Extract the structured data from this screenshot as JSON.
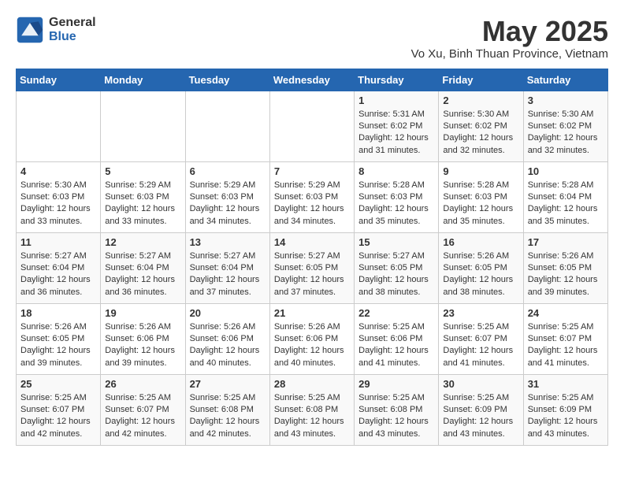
{
  "header": {
    "logo_general": "General",
    "logo_blue": "Blue",
    "month_year": "May 2025",
    "location": "Vo Xu, Binh Thuan Province, Vietnam"
  },
  "weekdays": [
    "Sunday",
    "Monday",
    "Tuesday",
    "Wednesday",
    "Thursday",
    "Friday",
    "Saturday"
  ],
  "weeks": [
    [
      {
        "day": "",
        "detail": ""
      },
      {
        "day": "",
        "detail": ""
      },
      {
        "day": "",
        "detail": ""
      },
      {
        "day": "",
        "detail": ""
      },
      {
        "day": "1",
        "detail": "Sunrise: 5:31 AM\nSunset: 6:02 PM\nDaylight: 12 hours\nand 31 minutes."
      },
      {
        "day": "2",
        "detail": "Sunrise: 5:30 AM\nSunset: 6:02 PM\nDaylight: 12 hours\nand 32 minutes."
      },
      {
        "day": "3",
        "detail": "Sunrise: 5:30 AM\nSunset: 6:02 PM\nDaylight: 12 hours\nand 32 minutes."
      }
    ],
    [
      {
        "day": "4",
        "detail": "Sunrise: 5:30 AM\nSunset: 6:03 PM\nDaylight: 12 hours\nand 33 minutes."
      },
      {
        "day": "5",
        "detail": "Sunrise: 5:29 AM\nSunset: 6:03 PM\nDaylight: 12 hours\nand 33 minutes."
      },
      {
        "day": "6",
        "detail": "Sunrise: 5:29 AM\nSunset: 6:03 PM\nDaylight: 12 hours\nand 34 minutes."
      },
      {
        "day": "7",
        "detail": "Sunrise: 5:29 AM\nSunset: 6:03 PM\nDaylight: 12 hours\nand 34 minutes."
      },
      {
        "day": "8",
        "detail": "Sunrise: 5:28 AM\nSunset: 6:03 PM\nDaylight: 12 hours\nand 35 minutes."
      },
      {
        "day": "9",
        "detail": "Sunrise: 5:28 AM\nSunset: 6:03 PM\nDaylight: 12 hours\nand 35 minutes."
      },
      {
        "day": "10",
        "detail": "Sunrise: 5:28 AM\nSunset: 6:04 PM\nDaylight: 12 hours\nand 35 minutes."
      }
    ],
    [
      {
        "day": "11",
        "detail": "Sunrise: 5:27 AM\nSunset: 6:04 PM\nDaylight: 12 hours\nand 36 minutes."
      },
      {
        "day": "12",
        "detail": "Sunrise: 5:27 AM\nSunset: 6:04 PM\nDaylight: 12 hours\nand 36 minutes."
      },
      {
        "day": "13",
        "detail": "Sunrise: 5:27 AM\nSunset: 6:04 PM\nDaylight: 12 hours\nand 37 minutes."
      },
      {
        "day": "14",
        "detail": "Sunrise: 5:27 AM\nSunset: 6:05 PM\nDaylight: 12 hours\nand 37 minutes."
      },
      {
        "day": "15",
        "detail": "Sunrise: 5:27 AM\nSunset: 6:05 PM\nDaylight: 12 hours\nand 38 minutes."
      },
      {
        "day": "16",
        "detail": "Sunrise: 5:26 AM\nSunset: 6:05 PM\nDaylight: 12 hours\nand 38 minutes."
      },
      {
        "day": "17",
        "detail": "Sunrise: 5:26 AM\nSunset: 6:05 PM\nDaylight: 12 hours\nand 39 minutes."
      }
    ],
    [
      {
        "day": "18",
        "detail": "Sunrise: 5:26 AM\nSunset: 6:05 PM\nDaylight: 12 hours\nand 39 minutes."
      },
      {
        "day": "19",
        "detail": "Sunrise: 5:26 AM\nSunset: 6:06 PM\nDaylight: 12 hours\nand 39 minutes."
      },
      {
        "day": "20",
        "detail": "Sunrise: 5:26 AM\nSunset: 6:06 PM\nDaylight: 12 hours\nand 40 minutes."
      },
      {
        "day": "21",
        "detail": "Sunrise: 5:26 AM\nSunset: 6:06 PM\nDaylight: 12 hours\nand 40 minutes."
      },
      {
        "day": "22",
        "detail": "Sunrise: 5:25 AM\nSunset: 6:06 PM\nDaylight: 12 hours\nand 41 minutes."
      },
      {
        "day": "23",
        "detail": "Sunrise: 5:25 AM\nSunset: 6:07 PM\nDaylight: 12 hours\nand 41 minutes."
      },
      {
        "day": "24",
        "detail": "Sunrise: 5:25 AM\nSunset: 6:07 PM\nDaylight: 12 hours\nand 41 minutes."
      }
    ],
    [
      {
        "day": "25",
        "detail": "Sunrise: 5:25 AM\nSunset: 6:07 PM\nDaylight: 12 hours\nand 42 minutes."
      },
      {
        "day": "26",
        "detail": "Sunrise: 5:25 AM\nSunset: 6:07 PM\nDaylight: 12 hours\nand 42 minutes."
      },
      {
        "day": "27",
        "detail": "Sunrise: 5:25 AM\nSunset: 6:08 PM\nDaylight: 12 hours\nand 42 minutes."
      },
      {
        "day": "28",
        "detail": "Sunrise: 5:25 AM\nSunset: 6:08 PM\nDaylight: 12 hours\nand 43 minutes."
      },
      {
        "day": "29",
        "detail": "Sunrise: 5:25 AM\nSunset: 6:08 PM\nDaylight: 12 hours\nand 43 minutes."
      },
      {
        "day": "30",
        "detail": "Sunrise: 5:25 AM\nSunset: 6:09 PM\nDaylight: 12 hours\nand 43 minutes."
      },
      {
        "day": "31",
        "detail": "Sunrise: 5:25 AM\nSunset: 6:09 PM\nDaylight: 12 hours\nand 43 minutes."
      }
    ]
  ]
}
